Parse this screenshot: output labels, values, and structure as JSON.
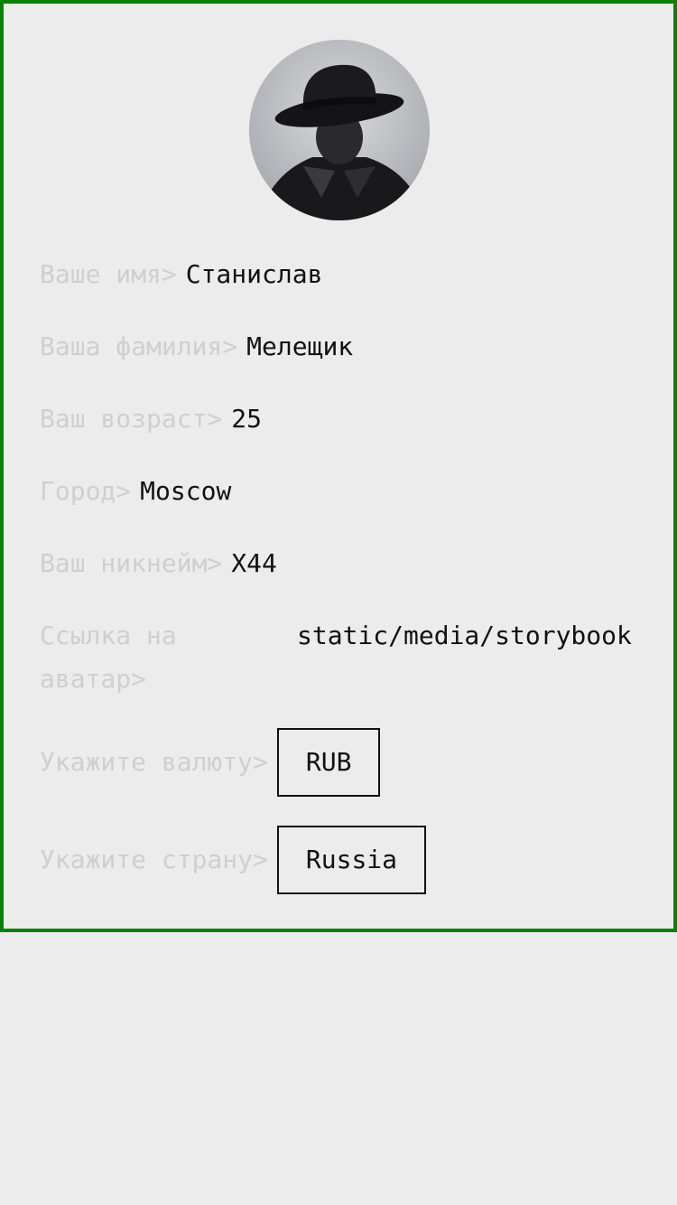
{
  "profile": {
    "avatar_icon": "user-avatar-photo",
    "fields": {
      "first_name": {
        "label": "Ваше имя>",
        "value": "Станислав"
      },
      "last_name": {
        "label": "Ваша фамилия>",
        "value": "Мелещик"
      },
      "age": {
        "label": "Ваш возраст>",
        "value": "25"
      },
      "city": {
        "label": "Город>",
        "value": "Moscow"
      },
      "nickname": {
        "label": "Ваш никнейм>",
        "value": "X44"
      },
      "avatar_link": {
        "label": "Ссылка на аватар>",
        "value": "static/media/storybook"
      },
      "currency": {
        "label": "Укажите валюту>",
        "value": "RUB"
      },
      "country": {
        "label": "Укажите страну>",
        "value": "Russia"
      }
    }
  },
  "colors": {
    "border": "#0a800a",
    "background": "#ececec",
    "label": "#cfcfcf",
    "value": "#111111"
  }
}
